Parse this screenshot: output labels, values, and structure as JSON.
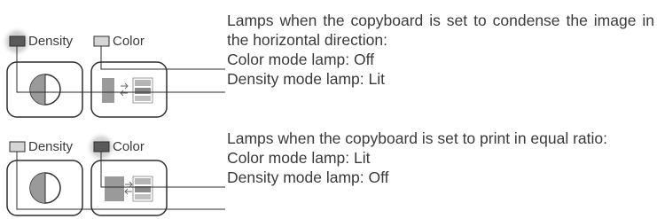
{
  "panels": [
    {
      "density_label": "Density",
      "color_label": "Color",
      "density_lamp": "lit",
      "color_lamp": "off",
      "description": "Lamps when the copyboard is set to condense the image in the horizontal direction:",
      "line_color": "Color mode lamp: Off",
      "line_density": "Density mode lamp: Lit"
    },
    {
      "density_label": "Density",
      "color_label": "Color",
      "density_lamp": "off",
      "color_lamp": "lit",
      "description": "Lamps when the copyboard is set to print in equal ratio:",
      "line_color": "Color mode lamp: Lit",
      "line_density": "Density mode lamp: Off"
    }
  ],
  "colors": {
    "lamp_lit": "#5a5a5a",
    "lamp_off": "#d6d6d6",
    "highlight": "#c4c4c4",
    "outline": "#2e2e2e",
    "text": "#3a3a3a"
  }
}
